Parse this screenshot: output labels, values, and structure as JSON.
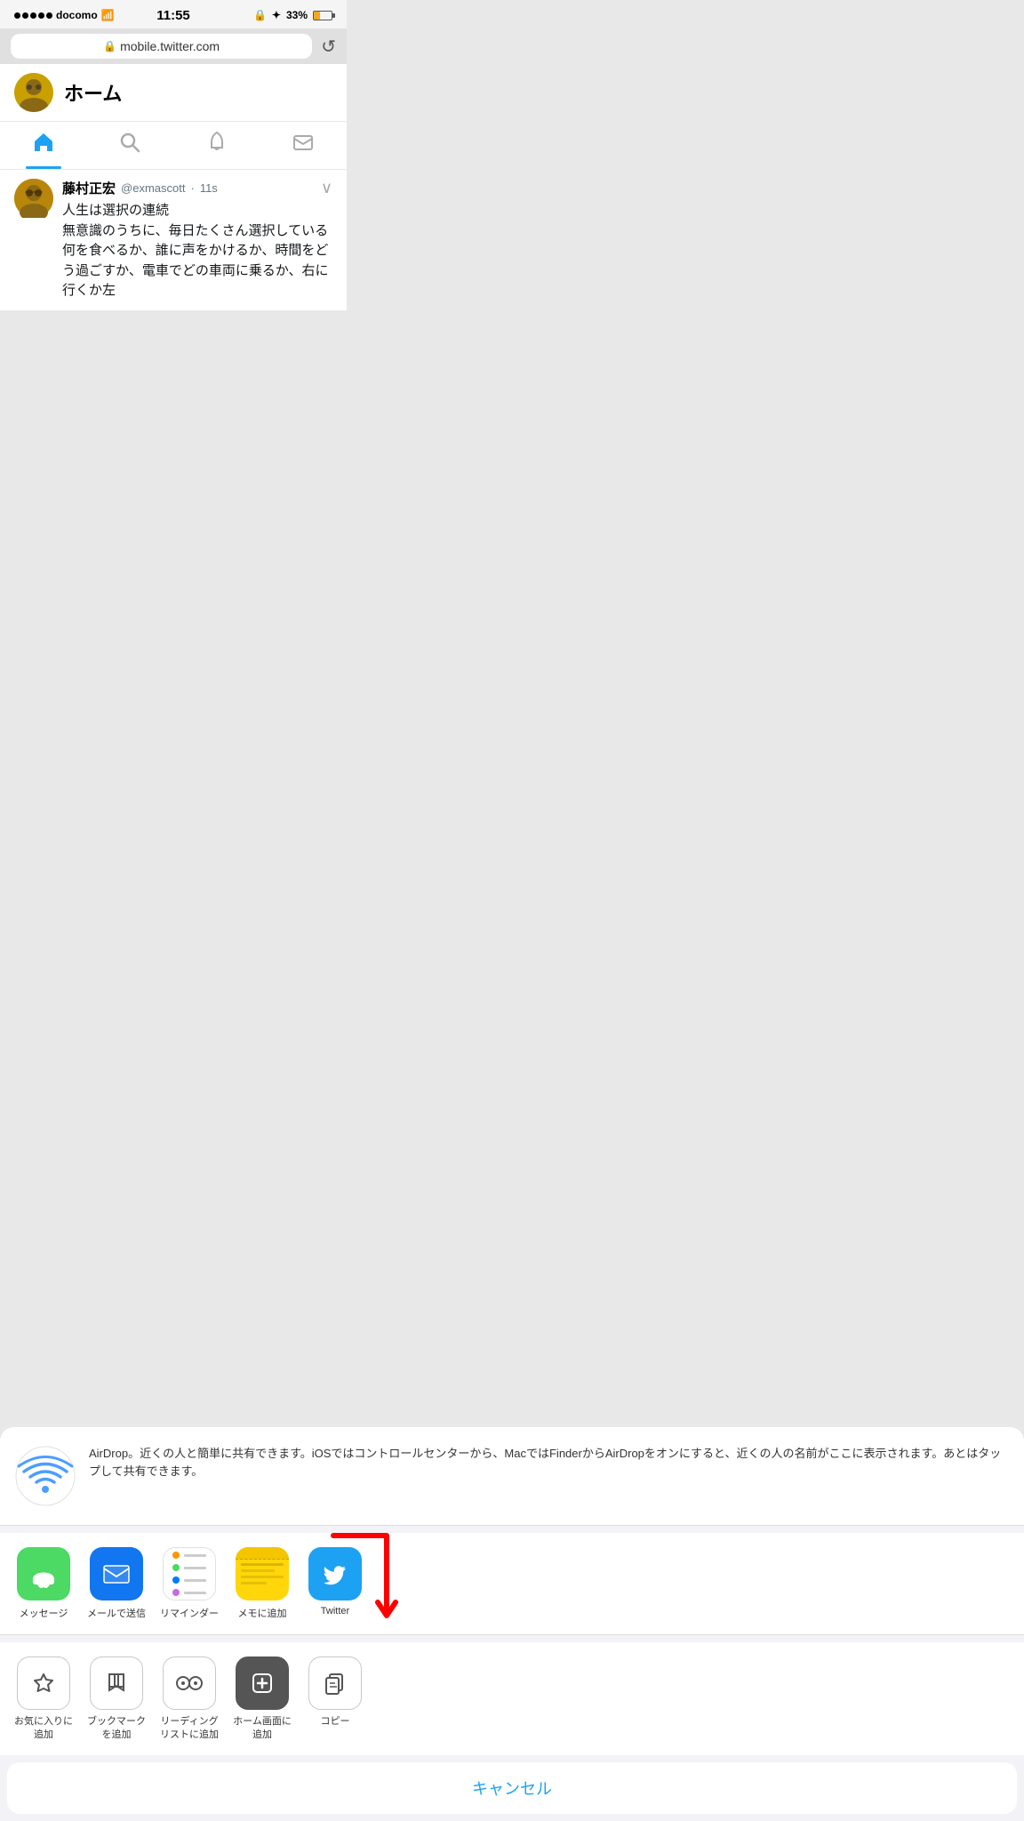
{
  "statusBar": {
    "carrier": "docomo",
    "signal": "●●●●●",
    "wifi": "WiFi",
    "time": "11:55",
    "lock_icon": "🔒",
    "bluetooth": "✦",
    "battery": "33%"
  },
  "urlBar": {
    "lock": "🔒",
    "url": "mobile.twitter.com",
    "reload": "↺"
  },
  "twitterHeader": {
    "avatar_emoji": "🧑",
    "title": "ホーム"
  },
  "navTabs": [
    {
      "icon": "🏠",
      "active": true
    },
    {
      "icon": "🔍",
      "active": false
    },
    {
      "icon": "🔔",
      "active": false
    },
    {
      "icon": "✉️",
      "active": false
    }
  ],
  "tweet": {
    "avatar_emoji": "🧑",
    "name": "藤村正宏",
    "handle": "@exmascott",
    "time": "11s",
    "text": "人生は選択の連続\n無意識のうちに、毎日たくさん選択している\n何を食べるか、誰に声をかけるか、時間をどう過ごすか、電車でどの車両に乗るか、右に行くか左"
  },
  "shareSheet": {
    "airdrop": {
      "description": "AirDrop。近くの人と簡単に共有できます。iOSではコントロールセンターから、MacではFinderからAirDropをオンにすると、近くの人の名前がここに表示されます。あとはタップして共有できます。"
    },
    "apps": [
      {
        "label": "メッセージ",
        "type": "messages"
      },
      {
        "label": "メールで送信",
        "type": "mail"
      },
      {
        "label": "リマインダー",
        "type": "reminders"
      },
      {
        "label": "メモに追加",
        "type": "notes"
      },
      {
        "label": "Twitter",
        "type": "twitter"
      }
    ],
    "actions": [
      {
        "label": "お気に入りに\n追加",
        "type": "star"
      },
      {
        "label": "ブックマーク\nを追加",
        "type": "bookmark"
      },
      {
        "label": "リーディング\nリストに追加",
        "type": "reading"
      },
      {
        "label": "ホーム画面に\n追加",
        "type": "home_add",
        "highlighted": true
      },
      {
        "label": "コピー",
        "type": "copy"
      }
    ],
    "cancel_label": "キャンセル"
  }
}
